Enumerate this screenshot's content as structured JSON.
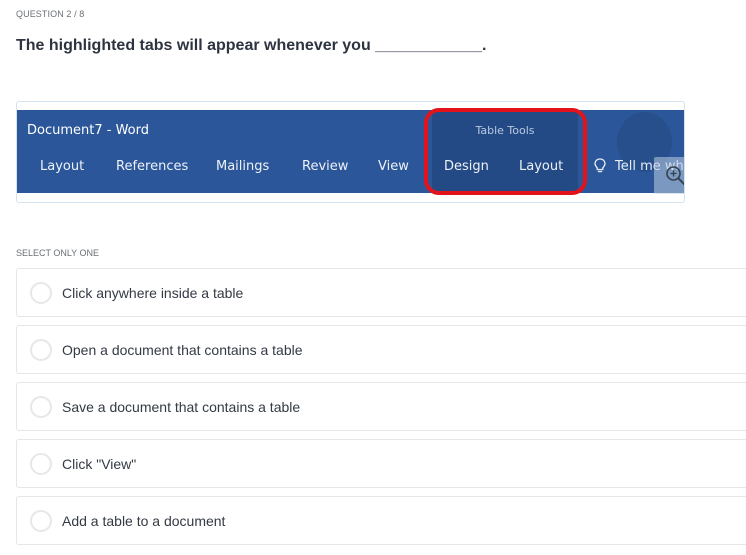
{
  "question": {
    "counter": "QUESTION 2 / 8",
    "prompt": "The highlighted tabs will appear whenever you ____________."
  },
  "figure": {
    "window_title": "Document7  -  Word",
    "tabs": [
      "Layout",
      "References",
      "Mailings",
      "Review",
      "View"
    ],
    "contextual_group": {
      "label": "Table Tools",
      "tabs": [
        "Design",
        "Layout"
      ],
      "highlighted": true
    },
    "tell_me": "Tell me wha",
    "colors": {
      "ribbon": "#2b579a",
      "contextual_group": "#244a85",
      "highlight_ring": "#e2131a"
    },
    "zoom_icon": "zoom-in-icon"
  },
  "answers": {
    "instruction": "SELECT ONLY ONE",
    "options": [
      {
        "label": "Click anywhere inside a table",
        "selected": false
      },
      {
        "label": "Open a document that contains a table",
        "selected": false
      },
      {
        "label": "Save a document that contains a table",
        "selected": false
      },
      {
        "label": "Click \"View\"",
        "selected": false
      },
      {
        "label": "Add a table to a document",
        "selected": false
      }
    ]
  }
}
